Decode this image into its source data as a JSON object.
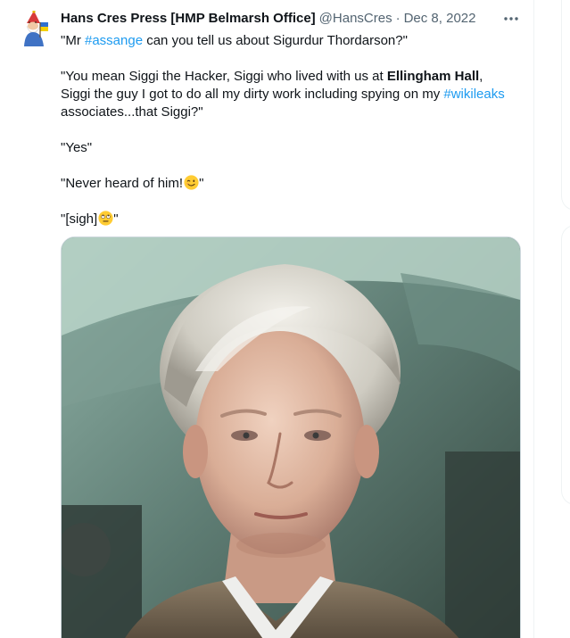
{
  "tweet": {
    "author_name": "Hans Cres Press [HMP Belmarsh Office]",
    "handle": "@HansCres",
    "separator": "·",
    "date": "Dec 8, 2022",
    "more_icon": "more-horizontal-icon",
    "avatar_icon": "gnome-avatar",
    "text": {
      "line1_pre": "\"Mr ",
      "line1_tag": "#assange",
      "line1_post": " can you tell us about Sigurdur Thordarson?\"",
      "p2_l1_pre": "\"You mean Siggi the Hacker, Siggi who lived with us at ",
      "p2_l1_bold": "Ellingham Hall",
      "p2_l1_post": ",",
      "p2_l2_pre": "Siggi the guy I got to do all my dirty work including spying on my ",
      "p2_l2_tag": "#wikileaks",
      "p2_l3": "associates...that Siggi?\"",
      "p3": "\"Yes\"",
      "p4_pre": "\"Never heard of him!",
      "p4_emoji": "winking-face-emoji",
      "p4_post": "\"",
      "p5_pre": "\"[sigh]",
      "p5_emoji": "rolling-eyes-emoji",
      "p5_post": "\""
    },
    "media": {
      "kind": "photo",
      "subject": "portrait of a man with white hair"
    }
  },
  "colors": {
    "text": "#0f1419",
    "secondary": "#536471",
    "link": "#1d9bf0",
    "border": "#eff3f4"
  }
}
